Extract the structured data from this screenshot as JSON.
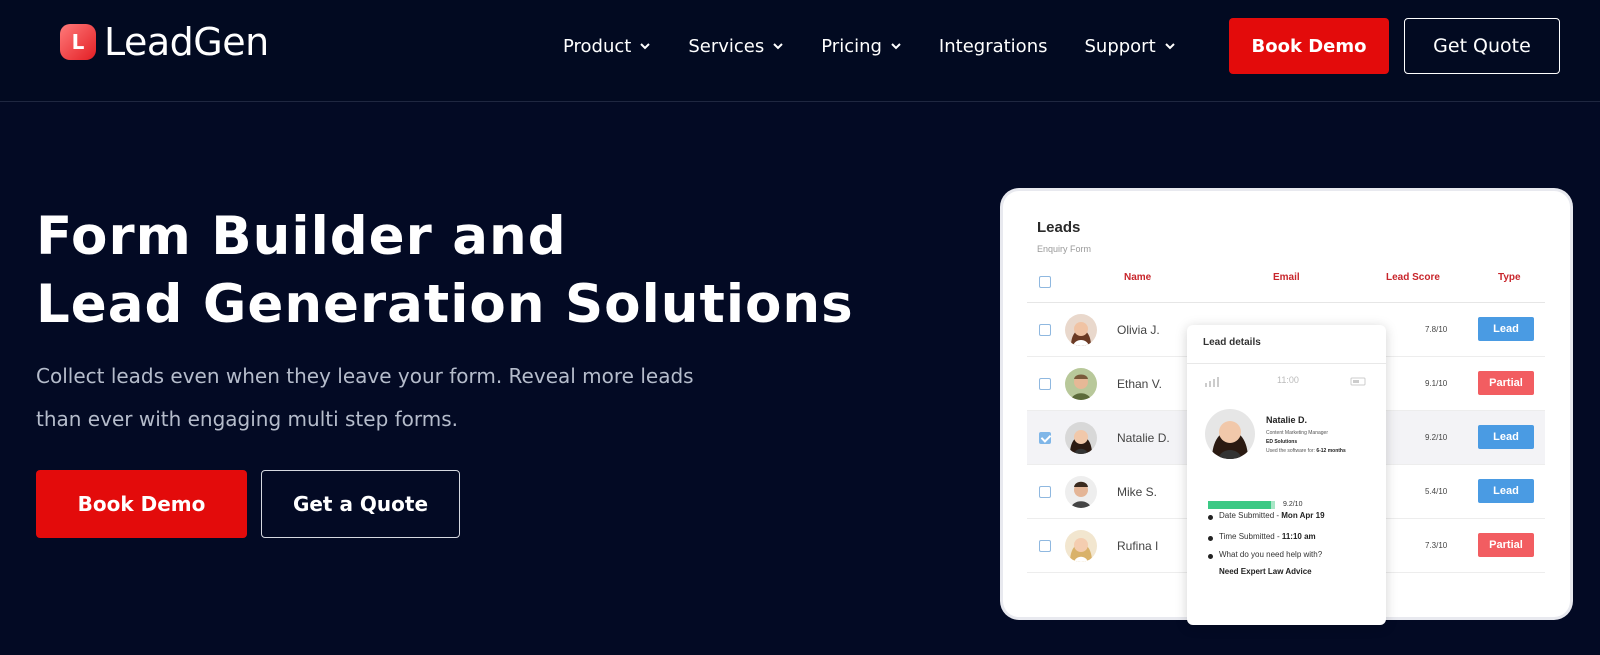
{
  "brand": {
    "name": "LeadGen",
    "logo_letter": "L",
    "accent": "#e30b0b"
  },
  "nav": {
    "items": [
      {
        "label": "Product",
        "has_dropdown": true
      },
      {
        "label": "Services",
        "has_dropdown": true
      },
      {
        "label": "Pricing",
        "has_dropdown": true
      },
      {
        "label": "Integrations",
        "has_dropdown": false
      },
      {
        "label": "Support",
        "has_dropdown": true
      }
    ],
    "book_demo": "Book Demo",
    "get_quote": "Get Quote"
  },
  "hero": {
    "title_line1": "Form Builder and",
    "title_line2": "Lead Generation Solutions",
    "subtitle_line1": "Collect leads even when they leave your form. Reveal more leads",
    "subtitle_line2": "than ever with engaging multi step forms.",
    "book_demo": "Book Demo",
    "get_quote": "Get a Quote"
  },
  "leads_card": {
    "title": "Leads",
    "subtitle": "Enquiry Form",
    "columns": [
      "Name",
      "Email",
      "Lead Score",
      "Type"
    ],
    "rows": [
      {
        "name": "Olivia J.",
        "score": "7.8/10",
        "type": "Lead",
        "checked": false
      },
      {
        "name": "Ethan V.",
        "score": "9.1/10",
        "type": "Partial",
        "checked": false
      },
      {
        "name": "Natalie D.",
        "score": "9.2/10",
        "type": "Lead",
        "checked": true
      },
      {
        "name": "Mike S.",
        "score": "5.4/10",
        "type": "Lead",
        "checked": false
      },
      {
        "name": "Rufina I",
        "score": "7.3/10",
        "type": "Partial",
        "checked": false
      }
    ]
  },
  "lead_details": {
    "title": "Lead details",
    "status_time": "11:00",
    "name": "Natalie D.",
    "role": "Content Marketing Manager",
    "company": "ED Solutions",
    "usage_prefix": "Used the software for:",
    "usage_value": "6-12 months",
    "score": "9.2/10",
    "score_fraction": 0.92,
    "date_label": "Date Submitted -",
    "date_value": "Mon Apr 19",
    "time_label": "Time Submitted -",
    "time_value": "11:10 am",
    "question": "What do you need help with?",
    "answer": "Need Expert Law Advice"
  }
}
